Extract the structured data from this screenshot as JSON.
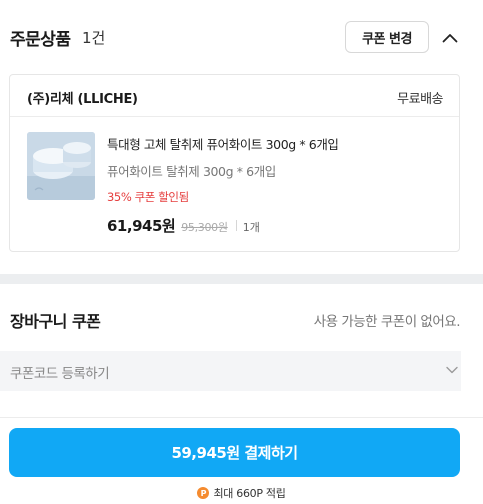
{
  "order_section": {
    "title": "주문상품",
    "count": "1건",
    "coupon_change_label": "쿠폰 변경"
  },
  "seller": {
    "name": "(주)리체 (LLICHE)",
    "shipping": "무료배송"
  },
  "product": {
    "name": "특대형 고체 탈취제 퓨어화이트 300g * 6개입",
    "option": "퓨어화이트 탈취제 300g * 6개입",
    "discount_note": "35% 쿠폰 할인됨",
    "sale_price": "61,945원",
    "original_price": "95,300원",
    "quantity": "1개"
  },
  "cart_coupon": {
    "title": "장바구니 쿠폰",
    "status": "사용 가능한 쿠폰이 없어요."
  },
  "coupon_code": {
    "label": "쿠폰코드 등록하기"
  },
  "footer": {
    "pay_label": "59,945원 결제하기",
    "points_badge": "P",
    "points_text": "최대 660P 적립"
  },
  "colors": {
    "accent": "#11a8f5",
    "discount": "#e53e3e",
    "points": "#f58b2f"
  }
}
